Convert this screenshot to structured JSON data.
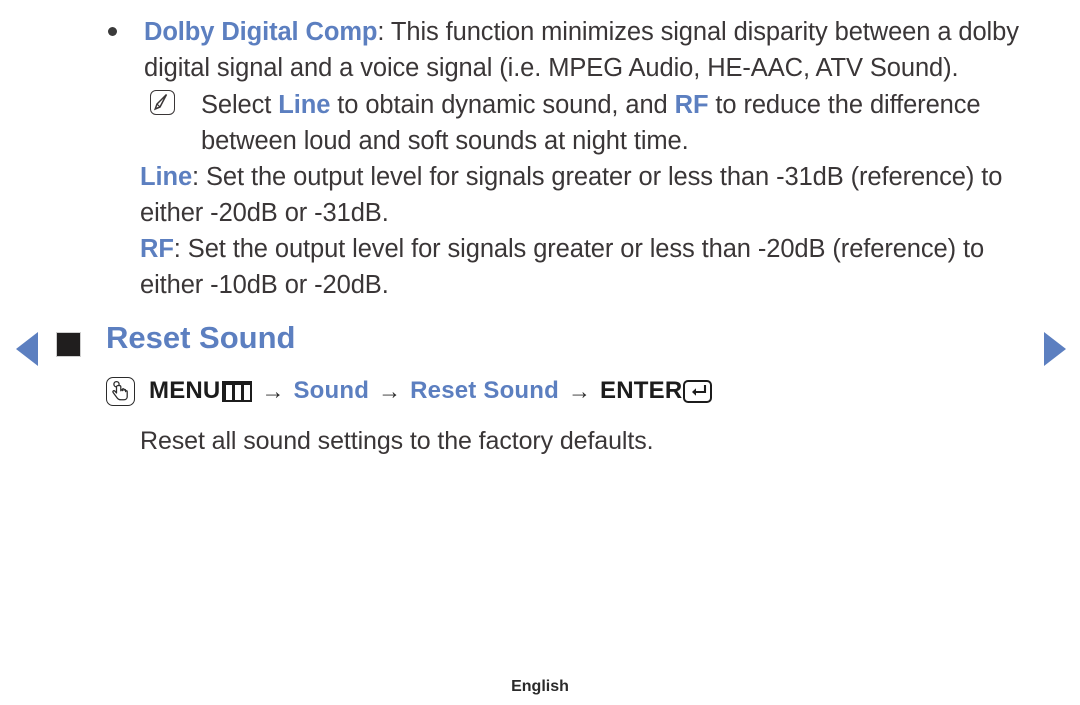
{
  "page": {
    "footer_label": "English",
    "accent_color": "#5c7fc0",
    "text_color": "#3a3637"
  },
  "navigation": {
    "prev_icon": "triangle-left-icon",
    "next_icon": "triangle-right-icon"
  },
  "bullet": {
    "icon": "bullet-dot-icon",
    "term": "Dolby Digital Comp",
    "colon": ": ",
    "body": "This function minimizes signal disparity between a dolby digital signal and a voice signal (i.e. MPEG Audio, HE-AAC, ATV Sound)."
  },
  "note": {
    "icon": "note-pencil-icon",
    "before": "Select ",
    "kw1": "Line",
    "middle": " to obtain dynamic sound, and ",
    "kw2": "RF",
    "after": " to reduce the difference between loud and soft sounds at night time."
  },
  "paragraphs": [
    {
      "term": "Line",
      "colon": ": ",
      "body": "Set the output level for signals greater or less than -31dB (reference) to either -20dB or -31dB."
    },
    {
      "term": "RF",
      "colon": ": ",
      "body": "Set the output level for signals greater or less than -20dB (reference) to either -10dB or -20dB."
    }
  ],
  "section": {
    "square_icon": "section-square-icon",
    "title": "Reset Sound",
    "description": "Reset all sound settings to the factory defaults."
  },
  "menu_path": {
    "touch_icon": "touch-hand-icon",
    "menu_label": "MENU",
    "menu_icon": "menu-bars-icon",
    "arrow1": "→",
    "step1": "Sound",
    "arrow2": "→",
    "step2": "Reset Sound",
    "arrow3": "→",
    "enter_label": "ENTER",
    "enter_icon": "enter-key-icon"
  }
}
